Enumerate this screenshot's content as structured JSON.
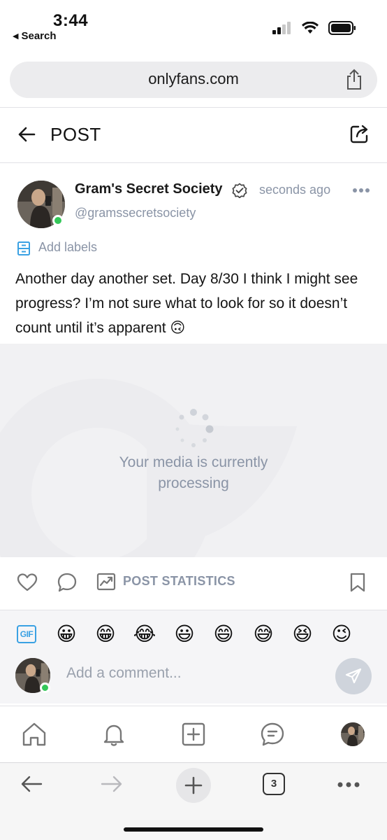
{
  "status_bar": {
    "time": "3:44",
    "back_label": "Search"
  },
  "browser": {
    "url": "onlyfans.com",
    "open_tabs": "3"
  },
  "header": {
    "title": "POST"
  },
  "post": {
    "author_name": "Gram's Secret Society",
    "author_handle": "@gramssecretsociety",
    "timestamp": "seconds ago",
    "add_labels": "Add labels",
    "text": "Another day another set. Day 8/30 I think I might see progress? I’m not sure what to look for so it doesn’t count until it’s apparent 🙃",
    "media_status_line1": "Your media is currently",
    "media_status_line2": "processing"
  },
  "actions": {
    "stats_label": "POST STATISTICS"
  },
  "comment": {
    "gif_label": "GIF",
    "emojis": [
      "😀",
      "😁",
      "😂",
      "😃",
      "😄",
      "😅",
      "😆",
      "😉"
    ],
    "placeholder": "Add a comment..."
  },
  "colors": {
    "muted": "#8a94a6",
    "accent": "#3aa1e3",
    "online": "#34c759"
  }
}
